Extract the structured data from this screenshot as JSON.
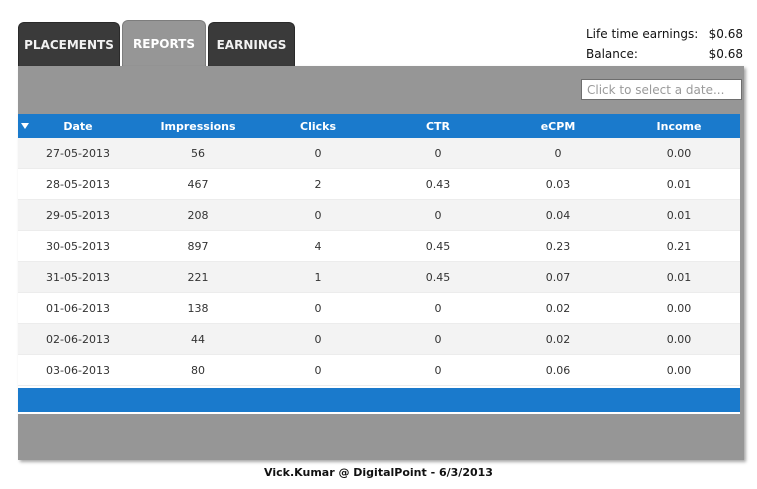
{
  "tabs": [
    {
      "label": "PLACEMENTS",
      "active": false
    },
    {
      "label": "REPORTS",
      "active": true
    },
    {
      "label": "EARNINGS",
      "active": false
    }
  ],
  "earnings": {
    "lifetime_label": "Life time earnings:",
    "lifetime_value": "$0.68",
    "balance_label": "Balance:",
    "balance_value": "$0.68"
  },
  "date_picker": {
    "placeholder": "Click to select a date..."
  },
  "table": {
    "columns": [
      "Date",
      "Impressions",
      "Clicks",
      "CTR",
      "eCPM",
      "Income"
    ],
    "rows": [
      [
        "27-05-2013",
        "56",
        "0",
        "0",
        "0",
        "0.00"
      ],
      [
        "28-05-2013",
        "467",
        "2",
        "0.43",
        "0.03",
        "0.01"
      ],
      [
        "29-05-2013",
        "208",
        "0",
        "0",
        "0.04",
        "0.01"
      ],
      [
        "30-05-2013",
        "897",
        "4",
        "0.45",
        "0.23",
        "0.21"
      ],
      [
        "31-05-2013",
        "221",
        "1",
        "0.45",
        "0.07",
        "0.01"
      ],
      [
        "01-06-2013",
        "138",
        "0",
        "0",
        "0.02",
        "0.00"
      ],
      [
        "02-06-2013",
        "44",
        "0",
        "0",
        "0.02",
        "0.00"
      ],
      [
        "03-06-2013",
        "80",
        "0",
        "0",
        "0.06",
        "0.00"
      ]
    ]
  },
  "caption": "Vick.Kumar @ DigitalPoint - 6/3/2013",
  "colors": {
    "header_blue": "#1a7acc",
    "panel_gray": "#969696",
    "tab_dark": "#3a3a3a"
  }
}
